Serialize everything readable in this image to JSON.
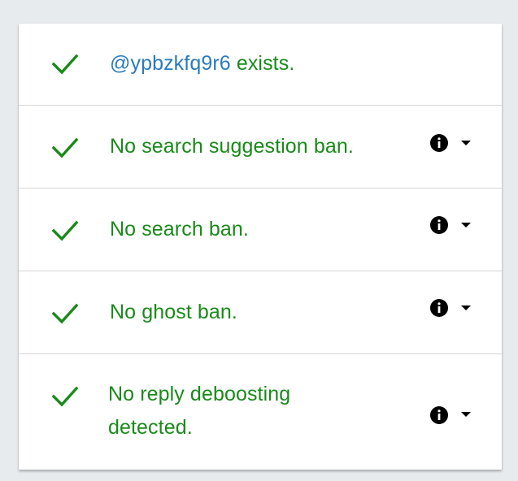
{
  "colors": {
    "success_green": "#1a8a1a",
    "handle_blue": "#2b7bbd",
    "background": "#e8ebee",
    "card": "#ffffff"
  },
  "results": [
    {
      "icon": "checkmark-icon",
      "handle": "@ypbzkfq9r6",
      "text": " exists."
    },
    {
      "icon": "checkmark-icon",
      "text": "No search suggestion ban.",
      "info_icon": "info-icon",
      "expand_icon": "caret-down-icon"
    },
    {
      "icon": "checkmark-icon",
      "text": "No search ban.",
      "info_icon": "info-icon",
      "expand_icon": "caret-down-icon"
    },
    {
      "icon": "checkmark-icon",
      "text": "No ghost ban.",
      "info_icon": "info-icon",
      "expand_icon": "caret-down-icon"
    },
    {
      "icon": "checkmark-icon",
      "text": "No reply deboosting detected.",
      "info_icon": "info-icon",
      "expand_icon": "caret-down-icon"
    }
  ]
}
